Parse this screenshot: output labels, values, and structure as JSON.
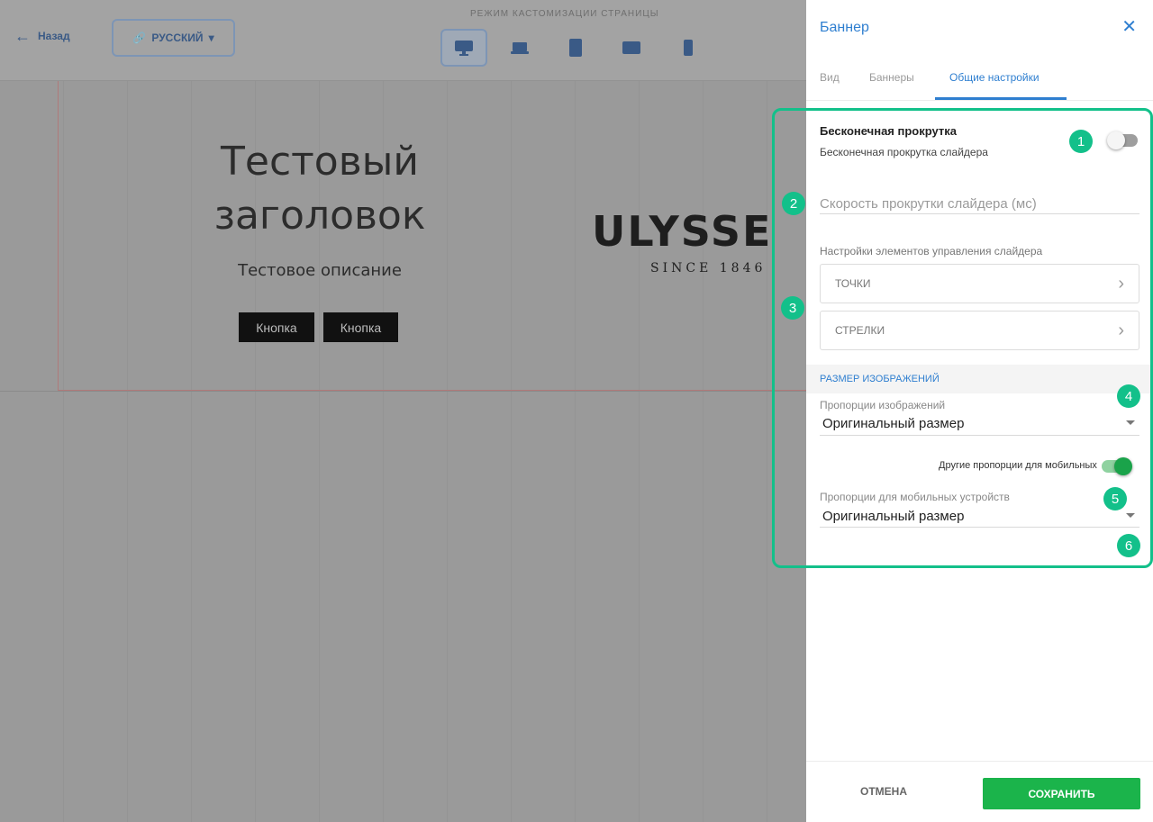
{
  "editor": {
    "back_label": "Назад",
    "language_label": "РУССКИЙ",
    "mode_label": "РЕЖИМ КАСТОМИЗАЦИИ СТРАНИЦЫ",
    "devices": [
      "desktop-icon",
      "laptop-icon",
      "tablet-icon",
      "tablet-landscape-icon",
      "mobile-icon"
    ],
    "banner": {
      "title": "Тестовый заголовок",
      "description": "Тестовое описание",
      "buttons": [
        "Кнопка",
        "Кнопка"
      ],
      "logo_text": "ULYSSE",
      "logo_sub": "SINCE 1846"
    }
  },
  "panel": {
    "title": "Баннер",
    "tabs": [
      {
        "label": "Вид"
      },
      {
        "label": "Баннеры"
      },
      {
        "label": "Общие настройки"
      }
    ],
    "active_tab": "Общие настройки",
    "infinite_scroll": {
      "title": "Бесконечная прокрутка",
      "subtitle": "Бесконечная прокрутка слайдера",
      "enabled": false
    },
    "speed_field": {
      "placeholder": "Скорость прокрутки слайдера (мс)"
    },
    "controls_label": "Настройки элементов управления слайдера",
    "controls": [
      {
        "label": "ТОЧКИ"
      },
      {
        "label": "СТРЕЛКИ"
      }
    ],
    "image_size_section": "РАЗМЕР ИЗОБРАЖЕНИЙ",
    "proportions": {
      "label": "Пропорции изображений",
      "value": "Оригинальный размер"
    },
    "mobile_toggle": {
      "label": "Другие пропорции для мобильных",
      "enabled": true
    },
    "mobile_proportions": {
      "label": "Пропорции для мобильных устройств",
      "value": "Оригинальный размер"
    },
    "cancel_label": "ОТМЕНА",
    "save_label": "СОХРАНИТЬ"
  },
  "callouts": [
    "1",
    "2",
    "3",
    "4",
    "5",
    "6"
  ],
  "colors": {
    "accent": "#2f7fd0",
    "callout": "#13c08a",
    "save": "#1bb44b"
  }
}
